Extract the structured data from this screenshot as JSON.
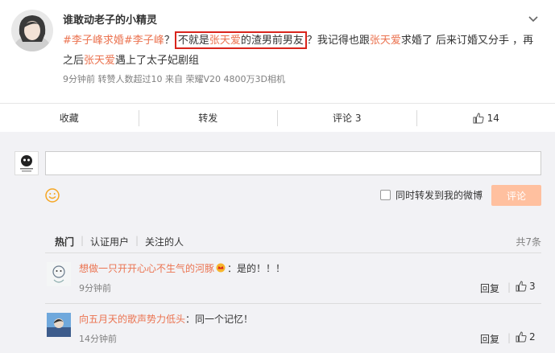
{
  "post": {
    "username": "谁敢动老子的小精灵",
    "content": {
      "tag1": "#李子峰求婚#",
      "tag2": "李子峰",
      "q1": "？",
      "hl_pre": "不就是",
      "hl_name": "张天爱",
      "hl_post": "的渣男前男友",
      "t1": "？我记得也跟",
      "name1": "张天爱",
      "t2": "求婚了 后来订婚又分手 ，再之后",
      "name2": "张天爱",
      "t3": "遇上了太子妃剧组"
    },
    "meta": "9分钟前 转赞人数超过10 来自 荣耀V20 4800万3D相机"
  },
  "actions": {
    "favorite": "收藏",
    "forward": "转发",
    "comment": "评论 3",
    "like_count": "14"
  },
  "composer": {
    "input_placeholder": "",
    "forward_checkbox_label": "同时转发到我的微博",
    "submit_label": "评论"
  },
  "filter": {
    "tab_hot": "热门",
    "tab_verified": "认证用户",
    "tab_following": "关注的人",
    "separator": "|",
    "total": "共7条"
  },
  "comments": [
    {
      "author": "想做一只开开心心不生气的河豚",
      "text": "：是的！！！",
      "time": "9分钟前",
      "reply_label": "回复",
      "likes": "3"
    },
    {
      "author": "向五月天的歌声势力低头",
      "text": "：同一个记忆！",
      "time": "14分钟前",
      "reply_label": "回复",
      "likes": "2"
    }
  ],
  "colors": {
    "link": "#eb7350",
    "highlight_border": "#d9251c",
    "submit_disabled": "#ffc09f",
    "comment_bg": "#f2f2f5"
  },
  "icons": [
    "chevron-down-icon",
    "thumb-up-icon",
    "smile-icon",
    "crown-icon"
  ]
}
